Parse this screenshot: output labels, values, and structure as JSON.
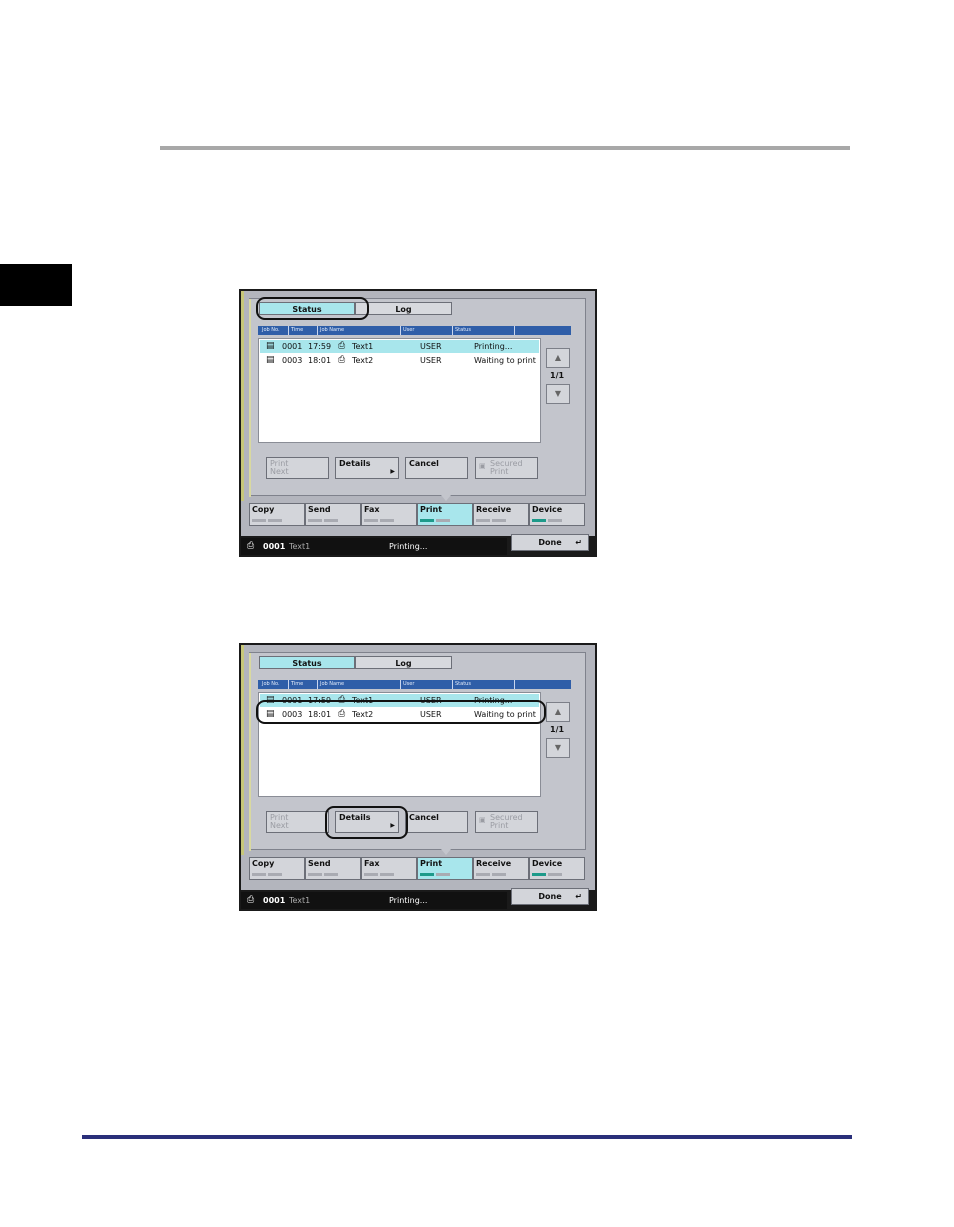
{
  "columns": [
    "Job No.",
    "Time",
    "Job Name",
    "User",
    "Status"
  ],
  "tabs": {
    "status": "Status",
    "log": "Log"
  },
  "jobs": [
    {
      "no": "0001",
      "time": "17:59",
      "name": "Text1",
      "user": "USER",
      "status": "Printing..."
    },
    {
      "no": "0003",
      "time": "18:01",
      "name": "Text2",
      "user": "USER",
      "status": "Waiting to print"
    }
  ],
  "page_count": "1/1",
  "buttons": {
    "print_next": "Print\nNext",
    "details": "Details",
    "cancel": "Cancel",
    "secured_print": "Secured\nPrint"
  },
  "modes": [
    "Copy",
    "Send",
    "Fax",
    "Print",
    "Receive",
    "Device"
  ],
  "status_line": {
    "job_no": "0001",
    "job_name": "Text1",
    "state": "Printing..."
  },
  "done": "Done",
  "colors": {
    "selected": "#a8e6ec",
    "header": "#2f5ea8",
    "lamp_on": "#1d9a8a",
    "rule_bottom": "#2a2f7a"
  }
}
